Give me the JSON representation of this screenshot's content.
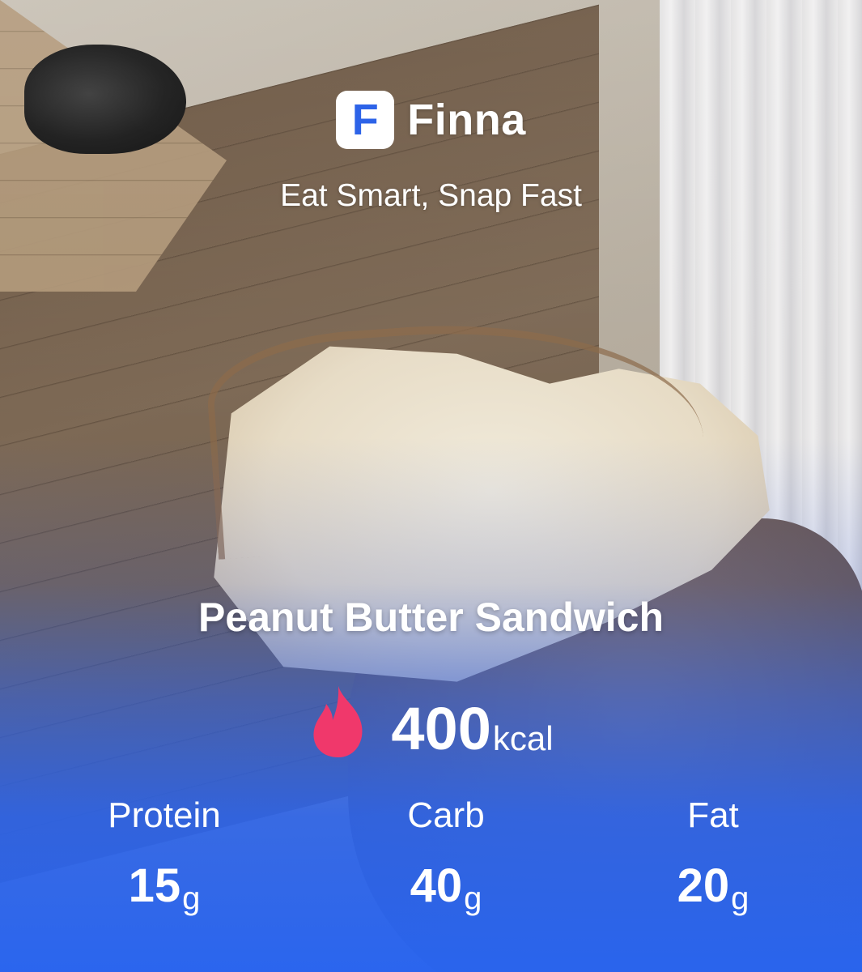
{
  "brand": {
    "logo_letter": "F",
    "name": "Finna",
    "tagline": "Eat Smart, Snap Fast"
  },
  "food": {
    "name": "Peanut Butter Sandwich"
  },
  "calories": {
    "value": "400",
    "unit": "kcal",
    "icon": "flame-icon"
  },
  "macros": [
    {
      "label": "Protein",
      "value": "15",
      "unit": "g"
    },
    {
      "label": "Carb",
      "value": "40",
      "unit": "g"
    },
    {
      "label": "Fat",
      "value": "20",
      "unit": "g"
    }
  ],
  "colors": {
    "accent_blue": "#2d63e8",
    "flame_pink": "#f0386b"
  }
}
